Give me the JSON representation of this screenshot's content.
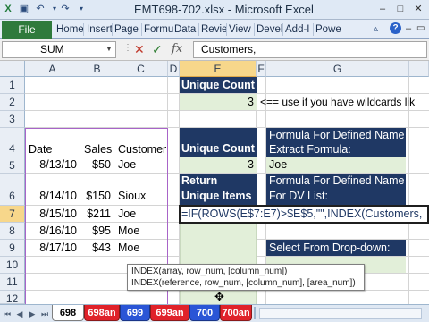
{
  "window": {
    "title": "EMT698-702.xlsx - Microsoft Excel"
  },
  "ribbon": {
    "file_label": "File",
    "tabs": [
      "Home",
      "Insert",
      "Page",
      "Formu",
      "Data",
      "Revie",
      "View",
      "Devel",
      "Add-I",
      "Powe"
    ]
  },
  "formula_bar": {
    "name_box": "SUM",
    "formula": "Customers,"
  },
  "columns": [
    "A",
    "B",
    "C",
    "D",
    "E",
    "F",
    "G"
  ],
  "rows": [
    "1",
    "2",
    "3",
    "4",
    "5",
    "6",
    "7",
    "8",
    "9",
    "10",
    "11",
    "12"
  ],
  "table": {
    "headers": {
      "date": "Date",
      "sales": "Sales",
      "customer": "Customer"
    },
    "records": [
      {
        "date": "8/13/10",
        "sales": "$50",
        "customer": "Joe"
      },
      {
        "date": "8/14/10",
        "sales": "$150",
        "customer": "Sioux"
      },
      {
        "date": "8/15/10",
        "sales": "$211",
        "customer": "Joe"
      },
      {
        "date": "8/16/10",
        "sales": "$95",
        "customer": "Moe"
      },
      {
        "date": "8/17/10",
        "sales": "$43",
        "customer": "Moe"
      }
    ]
  },
  "cells": {
    "e1": "Unique Count",
    "e2": "3",
    "f2_note": "<== use if you have wildcards lik",
    "e4": "Unique Count",
    "e5": "3",
    "e6": "Return\nUnique Items",
    "e7_formula": "=IF(ROWS(E$7:E7)>$E$5,\"\",INDEX(Customers,",
    "g4_line1": "Formula For Defined Name",
    "g4_line2": "Extract Formula:",
    "g5": "Joe",
    "g6_line1": "Formula For Defined Name",
    "g6_line2": "For DV List:",
    "g9": "Select From Drop-down:"
  },
  "tooltip": {
    "line1": "INDEX(array, row_num, [column_num])",
    "line2": "INDEX(reference, row_num, [column_num], [area_num])"
  },
  "sheet_tabs": [
    {
      "label": "698",
      "color": "#ffffff"
    },
    {
      "label": "698an",
      "color": "#e0222a"
    },
    {
      "label": "699",
      "color": "#2a55d6"
    },
    {
      "label": "699an",
      "color": "#e0222a"
    },
    {
      "label": "700",
      "color": "#2a55d6"
    },
    {
      "label": "700an",
      "color": "#e0222a"
    }
  ],
  "colors": {
    "navy": "#1f3864",
    "mint": "#e2efd9",
    "file_tab": "#2f7a3c",
    "selected_header": "#f7d78b"
  }
}
